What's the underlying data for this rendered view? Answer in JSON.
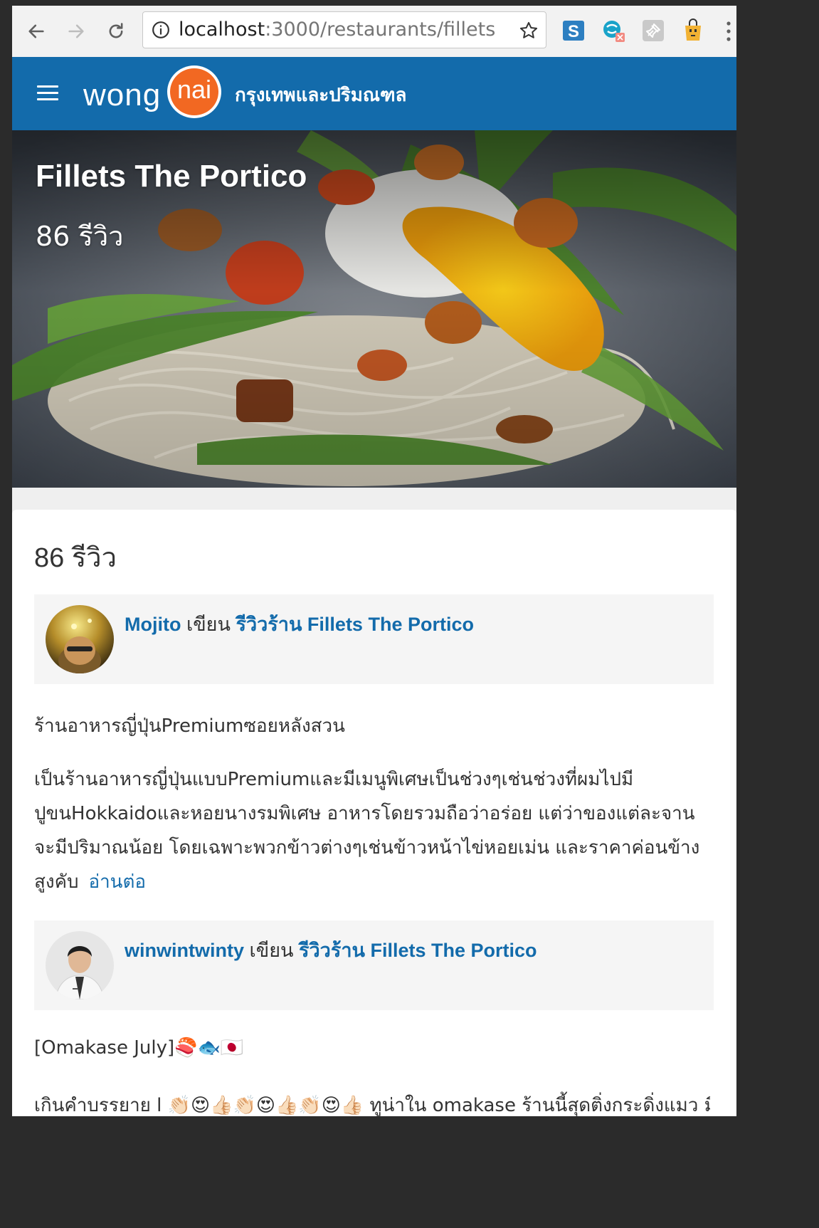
{
  "browser": {
    "url_host": "localhost",
    "url_path": ":3000/restaurants/fillets",
    "back_icon": "arrow-left-icon",
    "forward_icon": "arrow-right-icon",
    "reload_icon": "reload-icon",
    "bookmark_icon": "star-icon"
  },
  "header": {
    "logo_left": "wong",
    "logo_right": "nai",
    "region": "กรุงเทพและปริมณฑล",
    "brand_color": "#136bab",
    "logo_color": "#f26822"
  },
  "hero": {
    "title": "Fillets The Portico",
    "review_count": "86 รีวิว"
  },
  "reviews_section": {
    "title": "86 รีวิว",
    "reviews": [
      {
        "user": "Mojito",
        "verb": "เขียน",
        "link": "รีวิวร้าน Fillets The Portico",
        "title": "ร้านอาหารญี่ปุ่นPremiumซอยหลังสวน",
        "body": "เป็นร้านอาหารญี่ปุ่นแบบPremiumและมีเมนูพิเศษเป็นช่วงๆเช่นช่วงที่ผมไปมีปูขนHokkaidoและหอยนางรมพิเศษ อาหารโดยรวมถือว่าอร่อย แต่ว่าของแต่ละจานจะมีปริมาณน้อย โดยเฉพาะพวกข้าวต่างๆเช่นข้าวหน้าไข่หอยเม่น และราคาค่อนข้างสูงคับ",
        "read_more": "อ่านต่อ"
      },
      {
        "user": "winwintwinty",
        "verb": "เขียน",
        "link": "รีวิวร้าน Fillets The Portico",
        "title": "[Omakase July]🍣🐟🇯🇵",
        "body": "เกินคำบรรยาย l 👏🏻😍👍🏻👏🏻😍👍🏻👏🏻😍👍🏻 ทูน่าใน omakase ร้านนี้สุดติ่งกระดิ่งแมว มี"
      }
    ]
  }
}
